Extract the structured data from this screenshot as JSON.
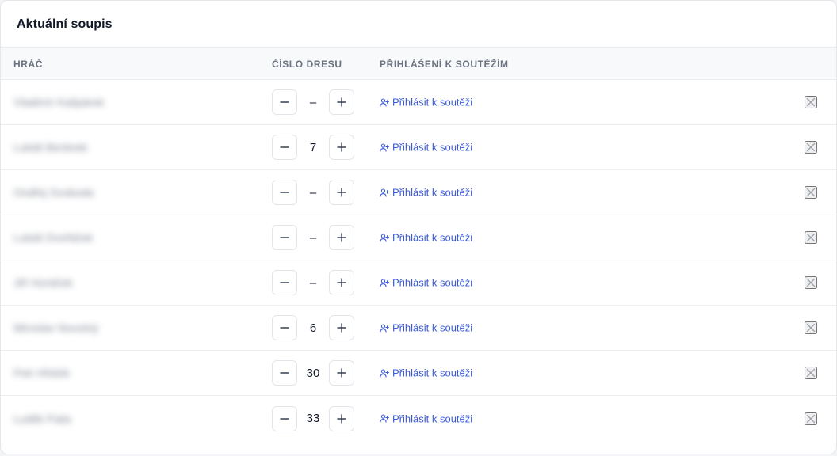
{
  "card": {
    "title": "Aktuální soupis"
  },
  "table": {
    "headers": {
      "player": "HRÁČ",
      "jersey": "ČÍSLO DRESU",
      "competitions": "PŘIHLÁŠENÍ K SOUTĚŽÍM"
    },
    "rows": [
      {
        "player": "Vladimír Kašpárek",
        "jersey": "–",
        "action": "Přihlásit k soutěži"
      },
      {
        "player": "Lukáš Beránek",
        "jersey": "7",
        "action": "Přihlásit k soutěži"
      },
      {
        "player": "Ondřej Svoboda",
        "jersey": "–",
        "action": "Přihlásit k soutěži"
      },
      {
        "player": "Lukáš Dvořáček",
        "jersey": "–",
        "action": "Přihlásit k soutěži"
      },
      {
        "player": "Jiří Horáček",
        "jersey": "–",
        "action": "Přihlásit k soutěži"
      },
      {
        "player": "Miroslav Novotný",
        "jersey": "6",
        "action": "Přihlásit k soutěži"
      },
      {
        "player": "Petr Hřebík",
        "jersey": "30",
        "action": "Přihlásit k soutěži"
      },
      {
        "player": "Luděk Fiala",
        "jersey": "33",
        "action": "Přihlásit k soutěži"
      }
    ]
  },
  "colors": {
    "link": "#3b5bdb",
    "border": "#e5e7eb",
    "header_bg": "#f8f9fb",
    "muted": "#6b7280"
  },
  "icons": {
    "decrement": "minus-icon",
    "increment": "plus-icon",
    "register": "user-plus-icon",
    "remove": "close-icon"
  }
}
